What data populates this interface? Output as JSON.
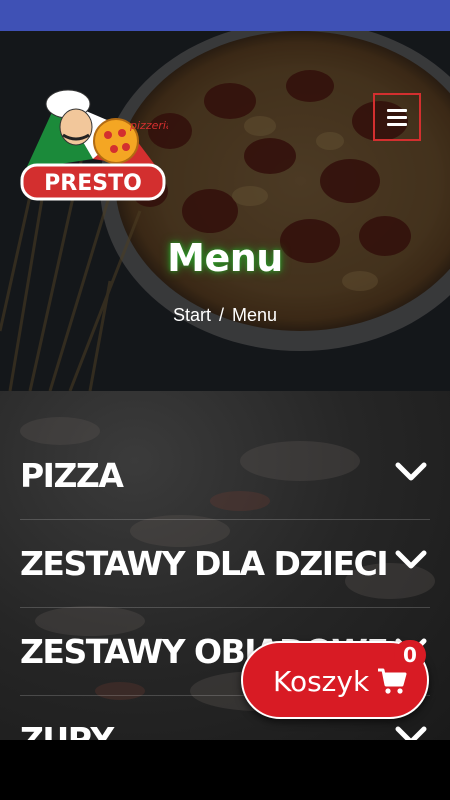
{
  "app": {
    "logo_brand": "PRESTO",
    "logo_sub": "pizzeria"
  },
  "header": {
    "menu_button_icon": "hamburger-icon"
  },
  "hero": {
    "title": "Menu",
    "breadcrumb": {
      "home": "Start",
      "separator": "/",
      "current": "Menu"
    }
  },
  "categories": [
    {
      "label": "PIZZA",
      "icon": "chevron-down-icon"
    },
    {
      "label": "ZESTAWY DLA DZIECI",
      "icon": "chevron-down-icon"
    },
    {
      "label": "ZESTAWY OBIADOWE",
      "icon": "chevron-down-icon"
    },
    {
      "label": "ZUPY",
      "icon": "chevron-down-icon"
    }
  ],
  "cart": {
    "label": "Koszyk",
    "icon": "cart-icon",
    "count": "0"
  },
  "colors": {
    "accent": "#d81b24",
    "status_bar": "#3f51b5",
    "title_glow": "#28a028"
  }
}
